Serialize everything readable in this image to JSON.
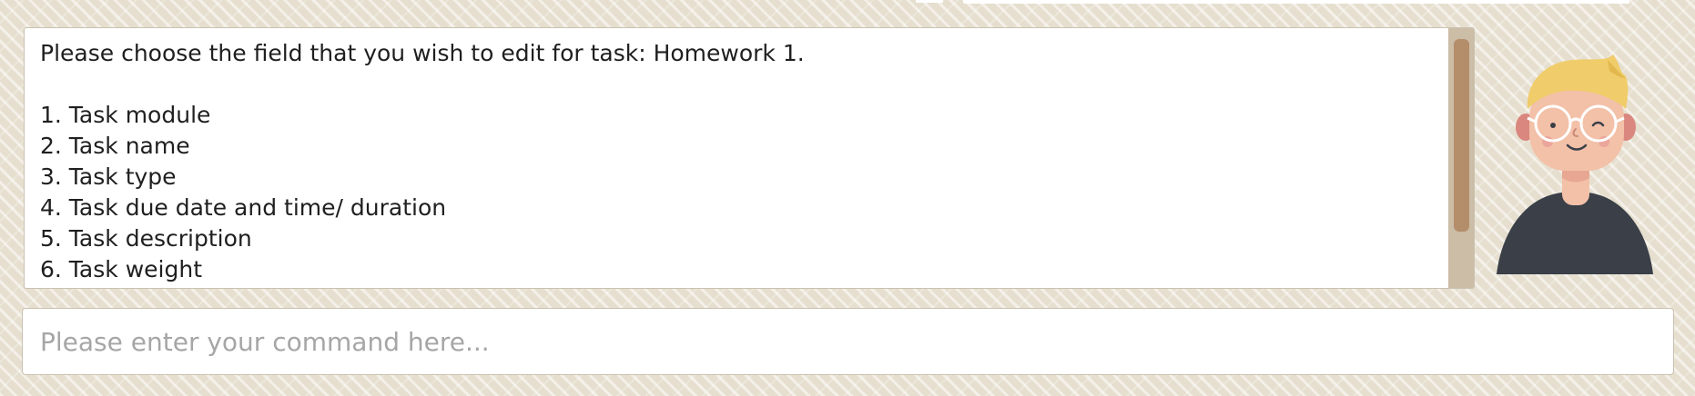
{
  "result_display": {
    "lines": [
      "Please choose the field that you wish to edit for task: Homework 1.",
      "",
      "1. Task module",
      "2. Task name",
      "3. Task type",
      "4. Task due date and time/ duration",
      "5. Task description",
      "6. Task weight"
    ]
  },
  "command_box": {
    "placeholder": "Please enter your command here..."
  },
  "colors": {
    "background": "#e6dfcf",
    "scroll_track": "#cbbda6",
    "scroll_thumb": "#b48d6a",
    "avatar_hair": "#f0cc6a",
    "avatar_skin": "#f3c0a8",
    "avatar_shirt": "#3a3f48"
  },
  "icons": {
    "avatar": "avatar-illustration"
  }
}
